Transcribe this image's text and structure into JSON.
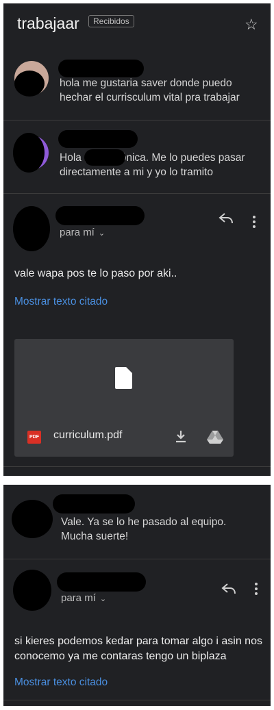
{
  "header": {
    "title": "trabajaar",
    "label": "Recibidos"
  },
  "messages": [
    {
      "snippet": "hola me gustaria saver donde puedo hechar el currisculum vital pra trabajar"
    },
    {
      "snippet": "Hola      , Soy Mónica. Me lo puedes pasar directamente a mi y yo lo tramito"
    },
    {
      "recipient": "para mí",
      "body": "vale wapa pos te lo paso por aki..",
      "show_quoted": "Mostrar texto citado",
      "attachment": {
        "filename": "curriculum.pdf",
        "type_badge": "PDF"
      }
    },
    {
      "snippet": "Vale. Ya se lo he pasado al equipo. Mucha suerte!"
    },
    {
      "recipient": "para mí",
      "body": "si kieres podemos kedar para tomar algo i asin nos conocemo ya me contaras tengo un biplaza",
      "show_quoted": "Mostrar texto citado"
    }
  ],
  "colors": {
    "background": "#202124",
    "link": "#4a8fe0",
    "pdf": "#d93025"
  }
}
